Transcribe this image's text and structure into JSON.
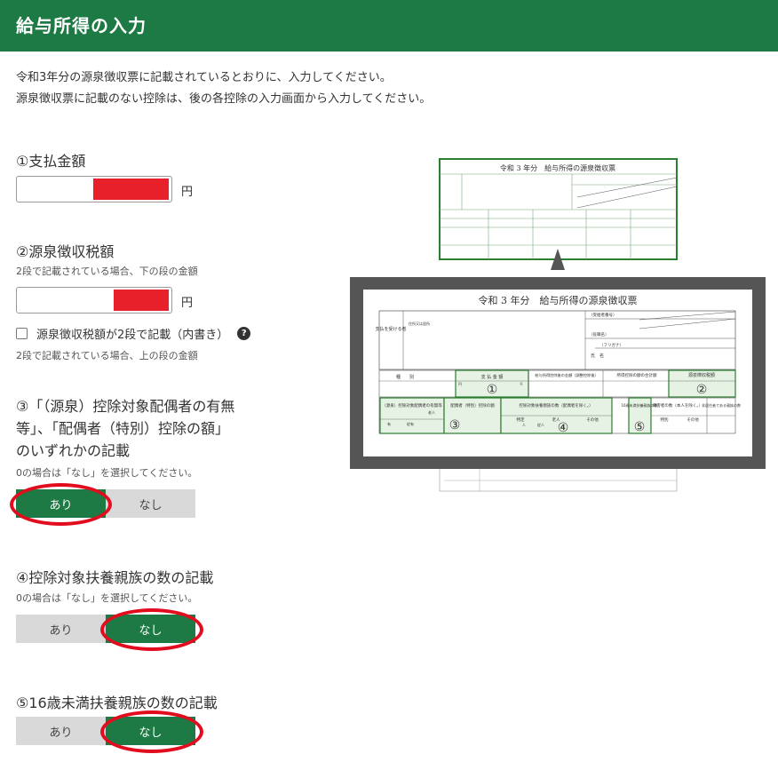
{
  "header": {
    "title": "給与所得の入力"
  },
  "intro": {
    "line1": "令和3年分の源泉徴収票に記載されているとおりに、入力してください。",
    "line2": "源泉徴収票に記載のない控除は、後の各控除の入力画面から入力してください。"
  },
  "q1": {
    "title": "①支払金額",
    "unit": "円",
    "value": ""
  },
  "q2": {
    "title": "②源泉徴収税額",
    "note_top": "2段で記載されている場合、下の段の金額",
    "unit": "円",
    "value": "",
    "checkbox_label": "源泉徴収税額が2段で記載（内書き）",
    "help_mark": "?",
    "note_bottom": "2段で記載されている場合、上の段の金額"
  },
  "q3": {
    "title_line1": "③「（源泉）控除対象配偶者の有無",
    "title_line2": "等」、「配偶者（特別）控除の額」",
    "title_line3": "のいずれかの記載",
    "note": "0の場合は「なし」を選択してください。",
    "yes": "あり",
    "no": "なし",
    "selected": "あり"
  },
  "q4": {
    "title": "④控除対象扶養親族の数の記載",
    "note": "0の場合は「なし」を選択してください。",
    "yes": "あり",
    "no": "なし",
    "selected": "なし"
  },
  "q5": {
    "title": "⑤16歳未満扶養親族の数の記載",
    "yes": "あり",
    "no": "なし",
    "selected": "なし"
  },
  "illustration": {
    "small_title": "令和 3 年分　給与所得の源泉徴収票",
    "zoom_title": "令和 3 年分　給与所得の源泉徴収票",
    "col_kind": "種　　別",
    "col_pay": "支 払 金 額",
    "col_after": "給与所得控除後の金額（調整控除後）",
    "col_total": "所得控除の額の合計額",
    "col_tax": "源泉徴収税額",
    "col_spouse": "（源泉）控除対象配偶者の有無等",
    "col_spouse_amt": "配偶者（特別）控除の額",
    "col_dep": "控除対象扶養親族の数（配偶者を除く。）",
    "col_u16": "16歳未満扶養親族の数",
    "col_dis": "障害者の数（本人を除く。）",
    "col_nonres": "非居住者である親族の数",
    "sub_special": "特定",
    "sub_elder": "老人",
    "sub_other": "その他",
    "sub_special2": "特別",
    "sub_other2": "その他",
    "sub_yes": "有",
    "sub_dep": "従有",
    "sub_elder2": "老人",
    "unit_en": "円",
    "unit_sen": "千",
    "unit_nin": "人",
    "unit_junin": "従人",
    "addr_label": "支払を受ける者",
    "addr_sub": "住所又は居所",
    "reg_no": "（受給者番号）",
    "kana": "（フリガナ）",
    "name": "氏　名",
    "role": "（役職名）",
    "m1": "①",
    "m2": "②",
    "m3": "③",
    "m4": "④",
    "m5": "⑤"
  }
}
